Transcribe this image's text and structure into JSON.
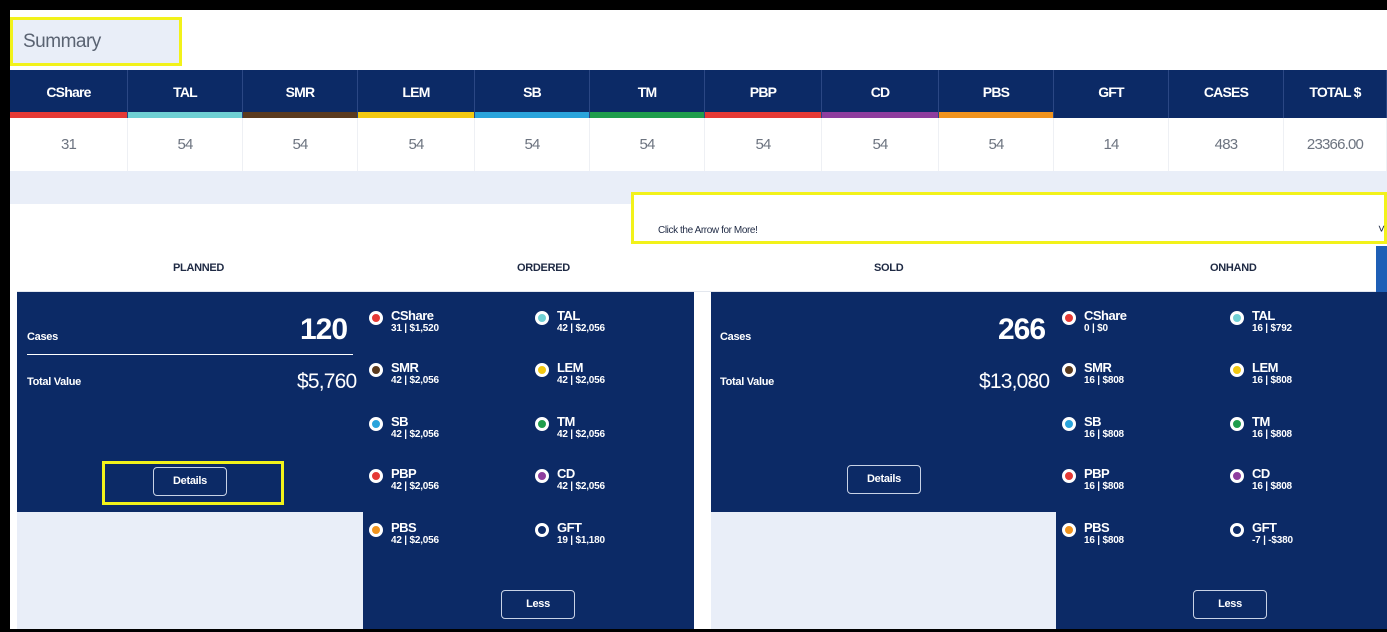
{
  "summary_tab": "Summary",
  "table": {
    "columns": [
      {
        "label": "CShare",
        "color": "#e53935",
        "value": "31"
      },
      {
        "label": "TAL",
        "color": "#6fd0d4",
        "value": "54"
      },
      {
        "label": "SMR",
        "color": "#5a3a1e",
        "value": "54"
      },
      {
        "label": "LEM",
        "color": "#f2c811",
        "value": "54"
      },
      {
        "label": "SB",
        "color": "#2aa4dc",
        "value": "54"
      },
      {
        "label": "TM",
        "color": "#1f9d4c",
        "value": "54"
      },
      {
        "label": "PBP",
        "color": "#e53935",
        "value": "54"
      },
      {
        "label": "CD",
        "color": "#8e3d9e",
        "value": "54"
      },
      {
        "label": "PBS",
        "color": "#f0931d",
        "value": "54"
      },
      {
        "label": "GFT",
        "color": "",
        "value": "14"
      },
      {
        "label": "CASES",
        "color": "",
        "value": "483"
      },
      {
        "label": "TOTAL $",
        "color": "",
        "value": "23366.00"
      }
    ]
  },
  "more_text": "Click the Arrow for More!",
  "more_arrow": "˅",
  "sections": [
    "PLANNED",
    "ORDERED",
    "SOLD",
    "ONHAND"
  ],
  "left_panel": {
    "cases_label": "Cases",
    "cases_value": "120",
    "total_label": "Total Value",
    "total_value": "$5,760",
    "details": "Details",
    "less": "Less",
    "items": [
      {
        "name": "CShare",
        "nums": "31  |  $1,520",
        "color": "#e53935"
      },
      {
        "name": "TAL",
        "nums": "42  |  $2,056",
        "color": "#6fd0d4"
      },
      {
        "name": "SMR",
        "nums": "42  |  $2,056",
        "color": "#5a3a1e"
      },
      {
        "name": "LEM",
        "nums": "42  |  $2,056",
        "color": "#f2c811"
      },
      {
        "name": "SB",
        "nums": "42  |  $2,056",
        "color": "#2aa4dc"
      },
      {
        "name": "TM",
        "nums": "42  |  $2,056",
        "color": "#1f9d4c"
      },
      {
        "name": "PBP",
        "nums": "42  |  $2,056",
        "color": "#e53935"
      },
      {
        "name": "CD",
        "nums": "42  |  $2,056",
        "color": "#8e3d9e"
      },
      {
        "name": "PBS",
        "nums": "42  |  $2,056",
        "color": "#f0931d"
      },
      {
        "name": "GFT",
        "nums": "19  |  $1,180",
        "color": "#0c2a66"
      }
    ]
  },
  "right_panel": {
    "cases_label": "Cases",
    "cases_value": "266",
    "total_label": "Total Value",
    "total_value": "$13,080",
    "details": "Details",
    "less": "Less",
    "items": [
      {
        "name": "CShare",
        "nums": "0  |  $0",
        "color": "#e53935"
      },
      {
        "name": "TAL",
        "nums": "16  |  $792",
        "color": "#6fd0d4"
      },
      {
        "name": "SMR",
        "nums": "16  |  $808",
        "color": "#5a3a1e"
      },
      {
        "name": "LEM",
        "nums": "16  |  $808",
        "color": "#f2c811"
      },
      {
        "name": "SB",
        "nums": "16  |  $808",
        "color": "#2aa4dc"
      },
      {
        "name": "TM",
        "nums": "16  |  $808",
        "color": "#1f9d4c"
      },
      {
        "name": "PBP",
        "nums": "16  |  $808",
        "color": "#e53935"
      },
      {
        "name": "CD",
        "nums": "16  |  $808",
        "color": "#8e3d9e"
      },
      {
        "name": "PBS",
        "nums": "16  |  $808",
        "color": "#f0931d"
      },
      {
        "name": "GFT",
        "nums": "-7  |  -$380",
        "color": "#0c2a66"
      }
    ]
  }
}
